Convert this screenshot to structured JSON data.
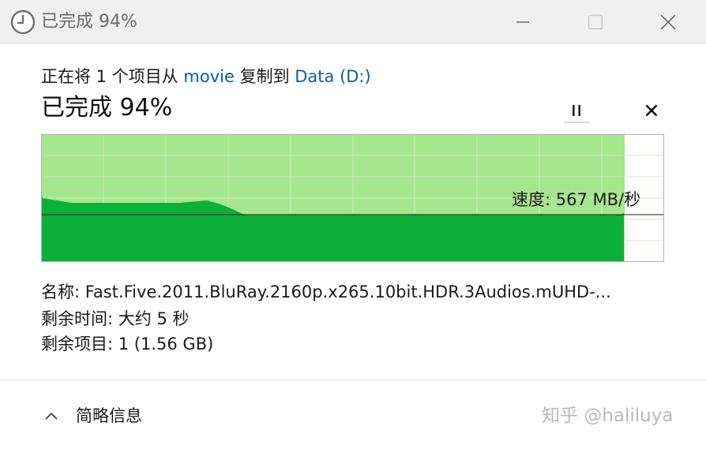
{
  "window": {
    "title": "已完成 94%",
    "icon": "clock-icon"
  },
  "copy": {
    "prefix": "正在将 1 个项目从 ",
    "source": "movie",
    "middle": " 复制到 ",
    "destination": "Data (D:)"
  },
  "progress": {
    "title": "已完成 94%",
    "percent": 94
  },
  "graph": {
    "speed_label": "速度: 567 MB/秒",
    "colors": {
      "completed": "#a6e68c",
      "speed": "#0cb038",
      "grid": "#cfe9c3",
      "line": "#222222"
    }
  },
  "details": {
    "name_label": "名称:",
    "name_value": "Fast.Five.2011.BluRay.2160p.x265.10bit.HDR.3Audios.mUHD-...",
    "time_label": "剩余时间:",
    "time_value": "大约 5 秒",
    "items_label": "剩余项目:",
    "items_value": "1 (1.56 GB)"
  },
  "footer": {
    "collapse_label": "简略信息",
    "watermark": "知乎 @haliluya"
  }
}
